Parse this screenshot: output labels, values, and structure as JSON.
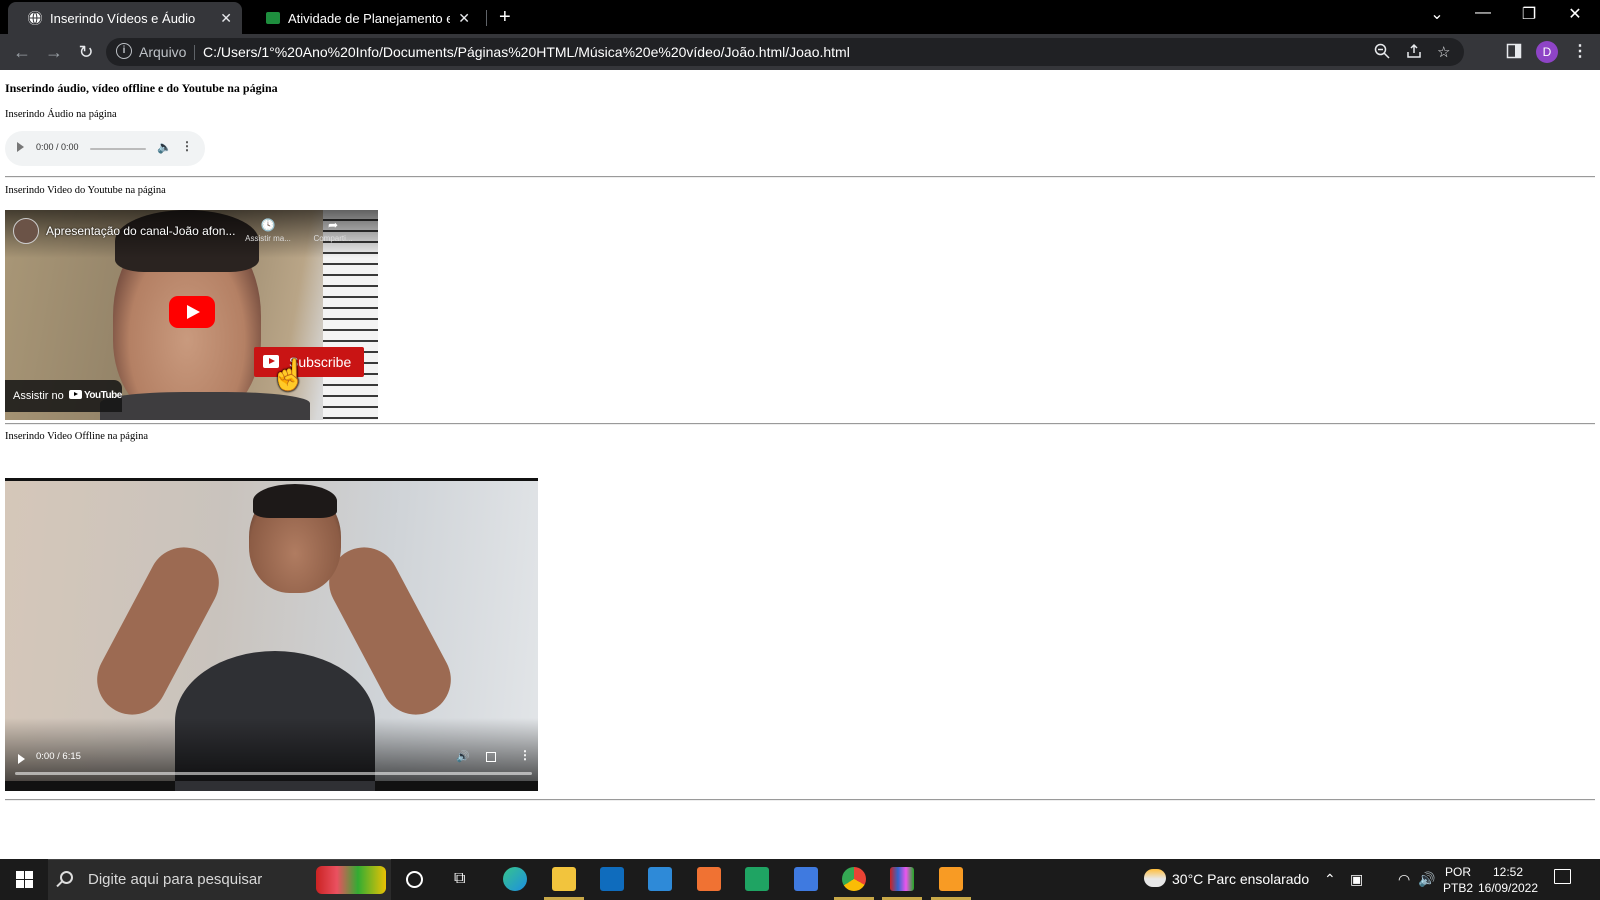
{
  "browser": {
    "tabs": [
      {
        "title": "Inserindo Vídeos e Áudio",
        "active": true
      },
      {
        "title": "Atividade de Planejamento e Car",
        "active": false
      }
    ],
    "new_tab_symbol": "+",
    "window_controls": [
      "chevron-down-icon",
      "minimize-icon",
      "restore-icon",
      "close-icon"
    ],
    "omnibox": {
      "scheme_label": "Arquivo",
      "url": "C:/Users/1°%20Ano%20Info/Documents/Páginas%20HTML/Música%20e%20vídeo/João.html/Joao.html"
    },
    "profile_initial": "D"
  },
  "page": {
    "heading": "Inserindo áudio, vídeo offline e do Youtube na página",
    "audio_label": "Inserindo Áudio na página",
    "audio_player": {
      "time": "0:00 / 0:00"
    },
    "youtube_label": "Inserindo Video do Youtube na página",
    "youtube_embed": {
      "title": "Apresentação do canal-João afon...",
      "watch_later": "Assistir ma...",
      "share": "Comparti...",
      "subscribe": "Subscribe",
      "watch_on": "Assistir no",
      "brand": "YouTube"
    },
    "offline_label": "Inserindo Video Offline na página",
    "video_player": {
      "time": "0:00 / 6:15"
    }
  },
  "taskbar": {
    "search_placeholder": "Digite aqui para pesquisar",
    "weather": "30°C  Parc ensolarado",
    "lang_1": "POR",
    "lang_2": "PTB2",
    "time": "12:52",
    "date": "16/09/2022",
    "app_icons": [
      "cortana-icon",
      "task-view-icon",
      "edge-icon",
      "file-explorer-icon",
      "store-icon",
      "mail-icon",
      "powerpoint-icon",
      "sheets-icon",
      "docs-icon",
      "chrome-icon",
      "app-icon",
      "sublime-icon"
    ],
    "colors": {
      "edge": "#1d8fe1",
      "explorer": "#f2c43d",
      "store": "#0f6cbd",
      "mail": "#2e8ad8",
      "powerpoint": "#f07233",
      "sheets": "#1fa463",
      "docs": "#3f7ae0",
      "sublime": "#f89b24"
    }
  }
}
